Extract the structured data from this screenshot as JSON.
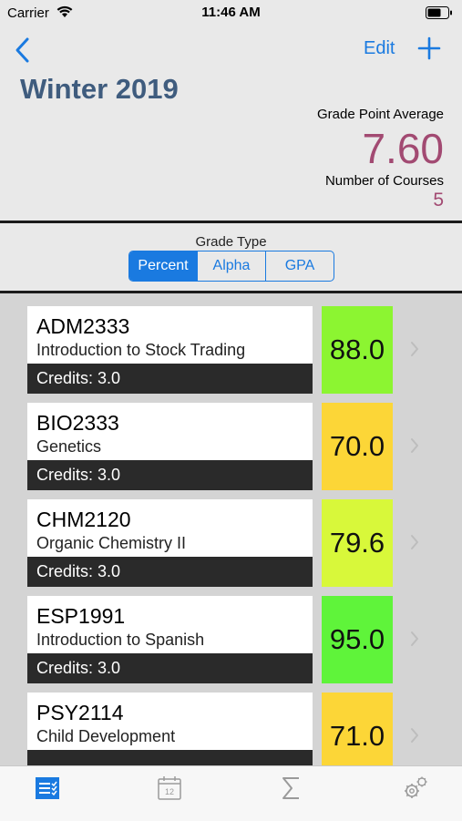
{
  "status_bar": {
    "carrier": "Carrier",
    "time": "11:46 AM"
  },
  "nav": {
    "edit_label": "Edit",
    "back_icon": "chevron-left-icon",
    "add_icon": "plus-icon"
  },
  "term": {
    "title": "Winter 2019",
    "gpa_label": "Grade Point Average",
    "gpa_value": "7.60",
    "courses_label": "Number of Courses",
    "courses_value": "5"
  },
  "grade_type": {
    "label": "Grade Type",
    "options": [
      "Percent",
      "Alpha",
      "GPA"
    ],
    "selected": "Percent"
  },
  "courses": [
    {
      "code": "ADM2333",
      "name": "Introduction to Stock Trading",
      "credits": "Credits: 3.0",
      "grade": "88.0",
      "color": "#8cf531"
    },
    {
      "code": "BIO2333",
      "name": "Genetics",
      "credits": "Credits: 3.0",
      "grade": "70.0",
      "color": "#fcd637"
    },
    {
      "code": "CHM2120",
      "name": "Organic Chemistry II",
      "credits": "Credits: 3.0",
      "grade": "79.6",
      "color": "#d8f83a"
    },
    {
      "code": "ESP1991",
      "name": "Introduction to Spanish",
      "credits": "Credits: 3.0",
      "grade": "95.0",
      "color": "#5ff43a"
    },
    {
      "code": "PSY2114",
      "name": "Child Development",
      "credits": "",
      "grade": "71.0",
      "color": "#fcd637"
    }
  ],
  "colors": {
    "accent": "#1a7ae0",
    "title": "#3f5c7e",
    "gpa": "#a24a72"
  },
  "tabs": [
    {
      "icon": "courses-list-icon",
      "active": true
    },
    {
      "icon": "calendar-icon",
      "label": "12",
      "active": false
    },
    {
      "icon": "sigma-icon",
      "active": false
    },
    {
      "icon": "settings-gears-icon",
      "active": false
    }
  ]
}
